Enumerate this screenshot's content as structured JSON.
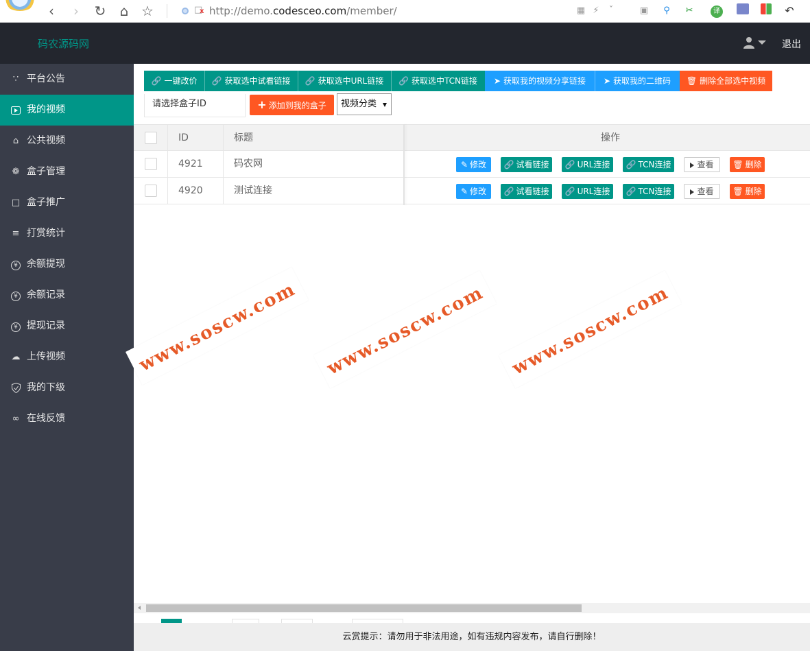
{
  "browser": {
    "url_prefix": "http://demo.",
    "url_domain": "codesceo.com",
    "url_path": "/member/"
  },
  "header": {
    "brand": "码农源码网",
    "logout": "退出"
  },
  "sidebar": {
    "items": [
      {
        "label": "平台公告",
        "icon": "announcement-icon",
        "glyph": "∵"
      },
      {
        "label": "我的视频",
        "icon": "video-icon",
        "glyph": "▶",
        "active": true
      },
      {
        "label": "公共视频",
        "icon": "home-icon",
        "glyph": "⌂"
      },
      {
        "label": "盒子管理",
        "icon": "palm-icon",
        "glyph": "❁"
      },
      {
        "label": "盒子推广",
        "icon": "promo-icon",
        "glyph": "□"
      },
      {
        "label": "打赏统计",
        "icon": "document-icon",
        "glyph": "≡"
      },
      {
        "label": "余额提现",
        "icon": "yuan-icon",
        "glyph": "¥"
      },
      {
        "label": "余额记录",
        "icon": "yuan-icon",
        "glyph": "¥"
      },
      {
        "label": "提现记录",
        "icon": "yuan-icon",
        "glyph": "¥"
      },
      {
        "label": "上传视频",
        "icon": "upload-icon",
        "glyph": "☁"
      },
      {
        "label": "我的下级",
        "icon": "shield-icon",
        "glyph": "✓"
      },
      {
        "label": "在线反馈",
        "icon": "link-loop-icon",
        "glyph": "∞"
      }
    ]
  },
  "toolbar": {
    "buttons": [
      {
        "label": "一键改价",
        "icon": "link-icon",
        "color": "#009688"
      },
      {
        "label": "获取选中试看链接",
        "icon": "link-icon",
        "color": "#009688"
      },
      {
        "label": "获取选中URL链接",
        "icon": "link-icon",
        "color": "#009688"
      },
      {
        "label": "获取选中TCN链接",
        "icon": "link-icon",
        "color": "#009688"
      },
      {
        "label": "获取我的视频分享链接",
        "icon": "share-icon",
        "color": "#1e9fff"
      },
      {
        "label": "获取我的二维码",
        "icon": "share-icon",
        "color": "#1e9fff"
      },
      {
        "label": "删除全部选中视频",
        "icon": "trash-icon",
        "color": "#ff5722"
      }
    ],
    "box_id_placeholder": "请选择盒子ID",
    "add_to_box": "添加到我的盒子",
    "category_select": "视频分类"
  },
  "table": {
    "headers": {
      "id": "ID",
      "title": "标题",
      "actions": "操作"
    },
    "rows": [
      {
        "id": "4921",
        "title": "码农网"
      },
      {
        "id": "4920",
        "title": "测试连接"
      }
    ],
    "row_actions": {
      "edit": "修改",
      "trial_link": "试看链接",
      "url_link": "URL连接",
      "tcn_link": "TCN连接",
      "view": "查看",
      "delete": "删除"
    }
  },
  "watermark": "www.soscw.com",
  "footer": "云赏提示：请勿用于非法用途，如有违规内容发布，请自行删除！",
  "colors": {
    "accent": "#009688",
    "blue": "#1e9fff",
    "danger": "#ff5722",
    "sidebar": "#393d49",
    "header": "#23262e"
  }
}
